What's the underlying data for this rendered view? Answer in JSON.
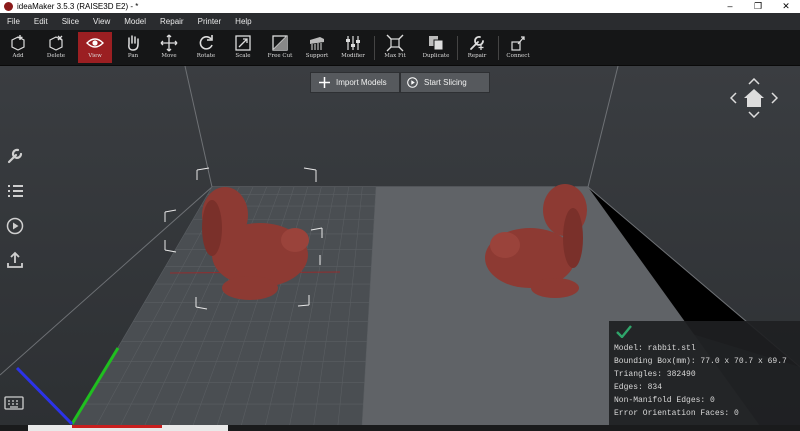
{
  "window": {
    "title": "ideaMaker 3.5.3 (RAISE3D E2) - *",
    "min": "–",
    "max": "❐",
    "close": "✕"
  },
  "menu": [
    "File",
    "Edit",
    "Slice",
    "View",
    "Model",
    "Repair",
    "Printer",
    "Help"
  ],
  "toolbar": {
    "tools": [
      {
        "label": "Add",
        "icon": "add-icon"
      },
      {
        "label": "Delete",
        "icon": "delete-icon"
      },
      {
        "label": "View",
        "icon": "eye-icon",
        "active": true
      },
      {
        "label": "Pan",
        "icon": "hand-icon"
      },
      {
        "label": "Move",
        "icon": "move-icon"
      },
      {
        "label": "Rotate",
        "icon": "rotate-icon"
      },
      {
        "label": "Scale",
        "icon": "scale-icon"
      },
      {
        "label": "Free Cut",
        "icon": "cut-icon"
      },
      {
        "label": "Support",
        "icon": "support-icon"
      },
      {
        "label": "Modifier",
        "icon": "modifier-icon"
      },
      {
        "label": "Max Fit",
        "icon": "maxfit-icon"
      },
      {
        "label": "Duplicate",
        "icon": "duplicate-icon"
      },
      {
        "label": "Repair",
        "icon": "repair-icon"
      },
      {
        "label": "Connect",
        "icon": "connect-icon"
      }
    ]
  },
  "actions": {
    "import": "Import Models",
    "slice": "Start Slicing"
  },
  "colors": {
    "active_tool": "#9b1f22",
    "model": "#8d3a33",
    "check": "#2fa56a"
  },
  "info": {
    "model": "Model: rabbit.stl",
    "bbox": "Bounding Box(mm): 77.0 x 70.7 x 69.7",
    "triangles": "Triangles: 382490",
    "edges": "Edges: 834",
    "nonmanifold": "Non-Manifold Edges: 0",
    "errorfaces": "Error Orientation Faces: 0"
  }
}
